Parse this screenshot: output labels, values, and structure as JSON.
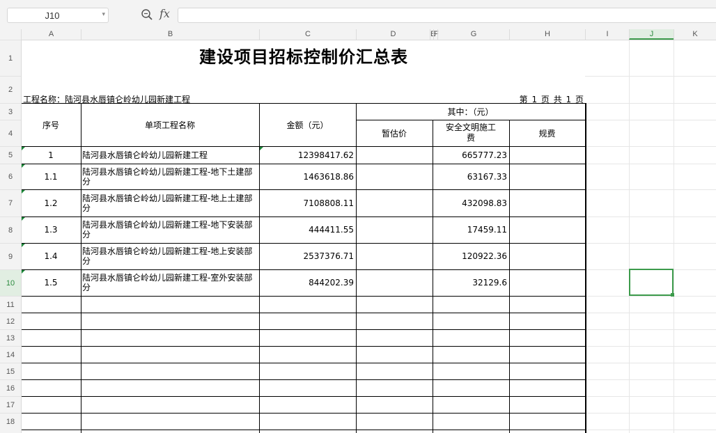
{
  "formula_bar": {
    "name_box": "J10",
    "fx_label": "fx",
    "formula_value": ""
  },
  "columns": [
    "A",
    "B",
    "C",
    "D",
    "E",
    "F",
    "G",
    "H",
    "I",
    "J",
    "K"
  ],
  "rows": [
    "1",
    "2",
    "3",
    "4",
    "5",
    "6",
    "7",
    "8",
    "9",
    "10",
    "11",
    "12",
    "13",
    "14",
    "15",
    "16",
    "17",
    "18"
  ],
  "selected_cell": "J10",
  "sheet": {
    "title": "建设项目招标控制价汇总表",
    "project_name": "工程名称：陆河县水唇镇仑岭幼儿园新建工程",
    "page_info": "第 1 页 共 1 页",
    "headers": {
      "seq": "序号",
      "item_name": "单项工程名称",
      "amount": "金额（元）",
      "of_which": "其中：（元）",
      "provisional": "暂估价",
      "safety": "安全文明施工费",
      "fees": "规费"
    },
    "items": [
      {
        "seq": "1",
        "name": "陆河县水唇镇仑岭幼儿园新建工程",
        "amount": "12398417.62",
        "provisional": "",
        "safety": "665777.23",
        "fees": ""
      },
      {
        "seq": "1.1",
        "name": "陆河县水唇镇仑岭幼儿园新建工程-地下土建部分",
        "amount": "1463618.86",
        "provisional": "",
        "safety": "63167.33",
        "fees": ""
      },
      {
        "seq": "1.2",
        "name": "陆河县水唇镇仑岭幼儿园新建工程-地上土建部分",
        "amount": "7108808.11",
        "provisional": "",
        "safety": "432098.83",
        "fees": ""
      },
      {
        "seq": "1.3",
        "name": "陆河县水唇镇仑岭幼儿园新建工程-地下安装部分",
        "amount": "444411.55",
        "provisional": "",
        "safety": "17459.11",
        "fees": ""
      },
      {
        "seq": "1.4",
        "name": "陆河县水唇镇仑岭幼儿园新建工程-地上安装部分",
        "amount": "2537376.71",
        "provisional": "",
        "safety": "120922.36",
        "fees": ""
      },
      {
        "seq": "1.5",
        "name": "陆河县水唇镇仑岭幼儿园新建工程-室外安装部分",
        "amount": "844202.39",
        "provisional": "",
        "safety": "32129.6",
        "fees": ""
      }
    ]
  }
}
